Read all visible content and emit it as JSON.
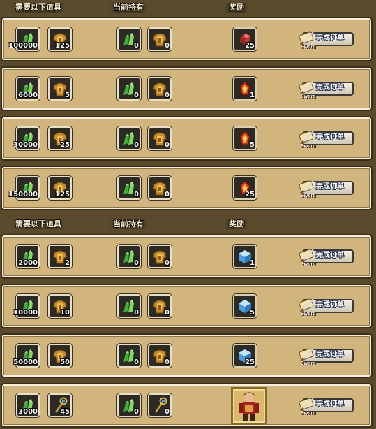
{
  "sections": [
    {
      "headers": {
        "required": "需要以下道具",
        "owned": "当前持有",
        "reward": "奖励"
      },
      "rows": [
        {
          "req": [
            {
              "icon": "green-crystal-icon",
              "qty": "100000"
            },
            {
              "icon": "golden-armor-icon",
              "qty": "125"
            }
          ],
          "own": [
            {
              "icon": "green-crystal-icon",
              "qty": "0"
            },
            {
              "icon": "golden-armor-icon",
              "qty": "0"
            }
          ],
          "reward": {
            "icon": "red-gem-icon",
            "qty": "25"
          },
          "button": "完成订单",
          "button_tag": "Sword"
        },
        {
          "req": [
            {
              "icon": "green-crystal-icon",
              "qty": "6000"
            },
            {
              "icon": "golden-armor-icon",
              "qty": "5"
            }
          ],
          "own": [
            {
              "icon": "green-crystal-icon",
              "qty": "0"
            },
            {
              "icon": "golden-armor-icon",
              "qty": "0"
            }
          ],
          "reward": {
            "icon": "fire-crystal-icon",
            "qty": "1"
          },
          "button": "完成订单",
          "button_tag": "Sword"
        },
        {
          "req": [
            {
              "icon": "green-crystal-icon",
              "qty": "30000"
            },
            {
              "icon": "golden-armor-icon",
              "qty": "25"
            }
          ],
          "own": [
            {
              "icon": "green-crystal-icon",
              "qty": "0"
            },
            {
              "icon": "golden-armor-icon",
              "qty": "0"
            }
          ],
          "reward": {
            "icon": "fire-crystal-icon",
            "qty": "5"
          },
          "button": "完成订单",
          "button_tag": "Sword"
        },
        {
          "req": [
            {
              "icon": "green-crystal-icon",
              "qty": "150000"
            },
            {
              "icon": "golden-armor-icon",
              "qty": "125"
            }
          ],
          "own": [
            {
              "icon": "green-crystal-icon",
              "qty": "0"
            },
            {
              "icon": "golden-armor-icon",
              "qty": "0"
            }
          ],
          "reward": {
            "icon": "fire-crystal-icon",
            "qty": "25"
          },
          "button": "完成订单",
          "button_tag": "Sword"
        }
      ]
    },
    {
      "headers": {
        "required": "需要以下道具",
        "owned": "当前持有",
        "reward": "奖励"
      },
      "rows": [
        {
          "req": [
            {
              "icon": "green-crystal-icon",
              "qty": "2000"
            },
            {
              "icon": "golden-armor-icon",
              "qty": "2"
            }
          ],
          "own": [
            {
              "icon": "green-crystal-icon",
              "qty": "0"
            },
            {
              "icon": "golden-armor-icon",
              "qty": "0"
            }
          ],
          "reward": {
            "icon": "blue-cube-icon",
            "qty": "1"
          },
          "button": "完成订单",
          "button_tag": "Sword"
        },
        {
          "req": [
            {
              "icon": "green-crystal-icon",
              "qty": "10000"
            },
            {
              "icon": "golden-armor-icon",
              "qty": "10"
            }
          ],
          "own": [
            {
              "icon": "green-crystal-icon",
              "qty": "0"
            },
            {
              "icon": "golden-armor-icon",
              "qty": "0"
            }
          ],
          "reward": {
            "icon": "blue-cube-icon",
            "qty": "5"
          },
          "button": "完成订单",
          "button_tag": "Sword"
        },
        {
          "req": [
            {
              "icon": "green-crystal-icon",
              "qty": "50000"
            },
            {
              "icon": "golden-armor-icon",
              "qty": "50"
            }
          ],
          "own": [
            {
              "icon": "green-crystal-icon",
              "qty": "0"
            },
            {
              "icon": "golden-armor-icon",
              "qty": "0"
            }
          ],
          "reward": {
            "icon": "blue-cube-icon",
            "qty": "25"
          },
          "button": "完成订单",
          "button_tag": "Sword"
        },
        {
          "req": [
            {
              "icon": "green-crystal-icon",
              "qty": "3000"
            },
            {
              "icon": "magic-staff-icon",
              "qty": "45"
            }
          ],
          "own": [
            {
              "icon": "green-crystal-icon",
              "qty": "0"
            },
            {
              "icon": "magic-staff-icon",
              "qty": "0"
            }
          ],
          "reward": {
            "icon": "hero-portrait-icon",
            "qty": ""
          },
          "button": "完成订单",
          "button_tag": "Sword"
        }
      ]
    }
  ]
}
